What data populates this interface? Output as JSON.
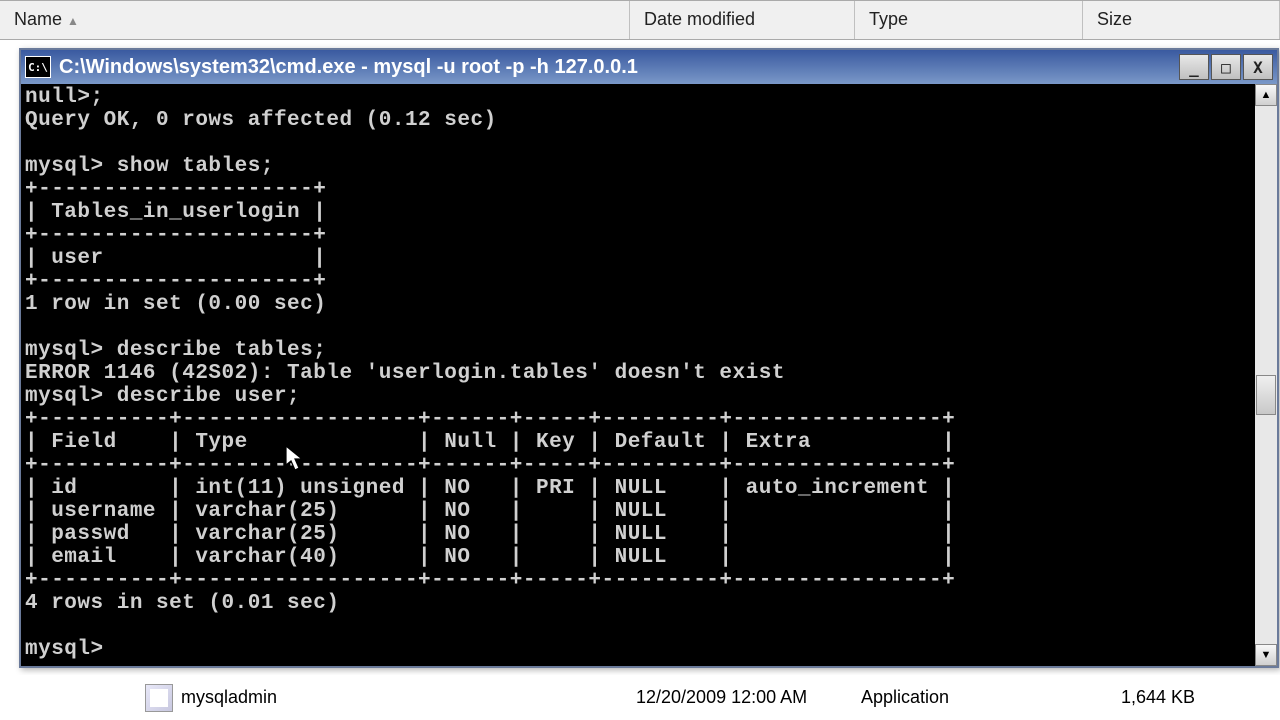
{
  "explorer": {
    "columns": {
      "name": "Name",
      "date": "Date modified",
      "type": "Type",
      "size": "Size"
    },
    "row": {
      "filename": "mysqladmin",
      "date": "12/20/2009 12:00 AM",
      "type": "Application",
      "size": "1,644 KB"
    }
  },
  "cmd": {
    "title_icon": "C:\\",
    "title": "C:\\Windows\\system32\\cmd.exe - mysql  -u root -p -h 127.0.0.1",
    "lines": [
      "null>;",
      "Query OK, 0 rows affected (0.12 sec)",
      "",
      "mysql> show tables;",
      "+---------------------+",
      "| Tables_in_userlogin |",
      "+---------------------+",
      "| user                |",
      "+---------------------+",
      "1 row in set (0.00 sec)",
      "",
      "mysql> describe tables;",
      "ERROR 1146 (42S02): Table 'userlogin.tables' doesn't exist",
      "mysql> describe user;",
      "+----------+------------------+------+-----+---------+----------------+",
      "| Field    | Type             | Null | Key | Default | Extra          |",
      "+----------+------------------+------+-----+---------+----------------+",
      "| id       | int(11) unsigned | NO   | PRI | NULL    | auto_increment |",
      "| username | varchar(25)      | NO   |     | NULL    |                |",
      "| passwd   | varchar(25)      | NO   |     | NULL    |                |",
      "| email    | varchar(40)      | NO   |     | NULL    |                |",
      "+----------+------------------+------+-----+---------+----------------+",
      "4 rows in set (0.01 sec)",
      "",
      "mysql>"
    ]
  },
  "win_btn": {
    "min": "_",
    "max": "□",
    "close": "X"
  },
  "scroll": {
    "up": "▲",
    "down": "▼"
  }
}
